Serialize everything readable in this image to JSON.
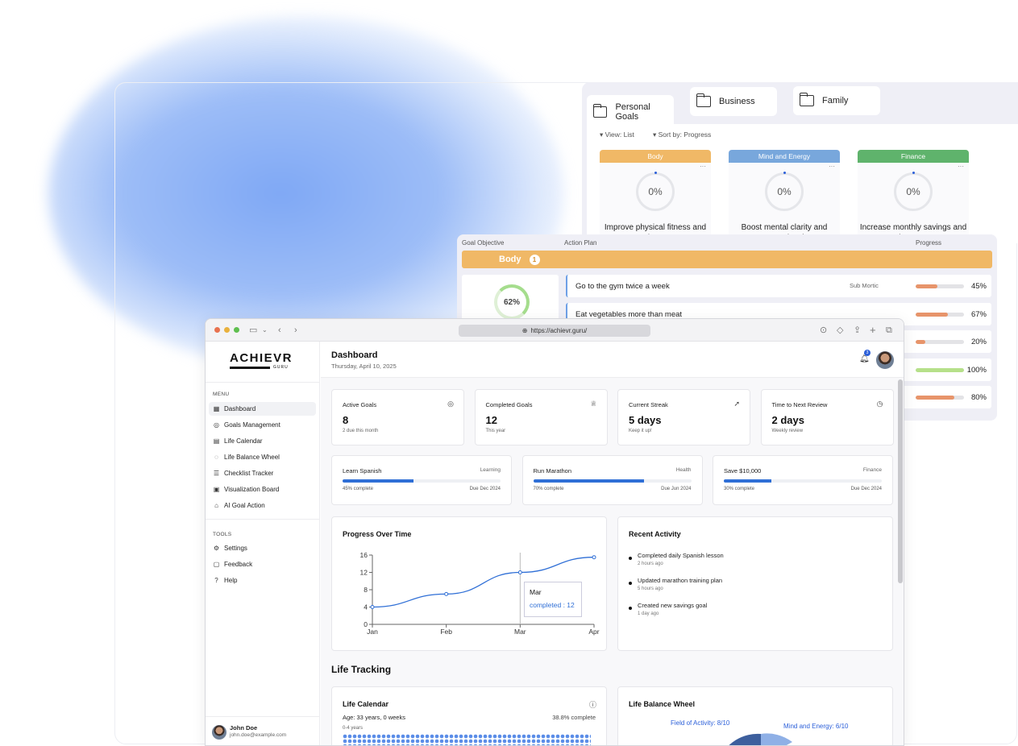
{
  "goals_board": {
    "tabs": [
      {
        "label": "Personal Goals"
      },
      {
        "label": "Business"
      },
      {
        "label": "Family"
      }
    ],
    "view_label": "View: List",
    "sort_label": "Sort by: Progress",
    "cards": [
      {
        "category": "Body",
        "color": "#f0b866",
        "progress": "0%",
        "title": "Improve physical fitness and endurance"
      },
      {
        "category": "Mind and Energy",
        "color": "#78a7dc",
        "progress": "0%",
        "title": "Boost mental clarity and energy levels"
      },
      {
        "category": "Finance",
        "color": "#5fb36c",
        "progress": "0%",
        "title": "Increase monthly savings and improve"
      }
    ]
  },
  "action_plan": {
    "col_objective": "Goal Objective",
    "col_plan": "Action Plan",
    "col_progress": "Progress",
    "group_label": "Body",
    "group_count": "1",
    "objective_progress": "62%",
    "rows": [
      {
        "text": "Go to the gym twice a week",
        "category": "Sub Mortic",
        "pct": "45%",
        "value": 0.45,
        "color": "#e7946a"
      },
      {
        "text": "Eat vegetables more than meat",
        "category": "",
        "pct": "67%",
        "value": 0.67,
        "color": "#e7946a"
      },
      {
        "text": "",
        "category": "",
        "pct": "20%",
        "value": 0.2,
        "color": "#e7946a"
      },
      {
        "text": "",
        "category": "",
        "pct": "100%",
        "value": 1.0,
        "color": "#b6e08a"
      },
      {
        "text": "",
        "category": "",
        "pct": "80%",
        "value": 0.8,
        "color": "#e7946a"
      }
    ]
  },
  "browser": {
    "url": "https://achievr.guru/"
  },
  "sidebar": {
    "logo": "ACHIEVR",
    "logo_sub": "GURU",
    "menu_heading": "MENU",
    "menu": [
      {
        "label": "Dashboard",
        "icon": "grid-icon"
      },
      {
        "label": "Goals Management",
        "icon": "target-icon"
      },
      {
        "label": "Life Calendar",
        "icon": "calendar-icon"
      },
      {
        "label": "Life Balance Wheel",
        "icon": "wheel-icon"
      },
      {
        "label": "Checklist Tracker",
        "icon": "checklist-icon"
      },
      {
        "label": "Visualization Board",
        "icon": "image-icon"
      },
      {
        "label": "AI Goal Action",
        "icon": "robot-icon"
      }
    ],
    "tools_heading": "TOOLS",
    "tools": [
      {
        "label": "Settings",
        "icon": "gear-icon"
      },
      {
        "label": "Feedback",
        "icon": "chat-icon"
      },
      {
        "label": "Help",
        "icon": "help-icon"
      }
    ],
    "user": {
      "name": "John Doe",
      "email": "john.doe@example.com"
    }
  },
  "header": {
    "title": "Dashboard",
    "date": "Thursday, April 10, 2025",
    "notifications": "3"
  },
  "stats": [
    {
      "label": "Active Goals",
      "value": "8",
      "sub": "2 due this month",
      "icon": "target-icon"
    },
    {
      "label": "Completed Goals",
      "value": "12",
      "sub": "This year",
      "icon": "trophy-icon"
    },
    {
      "label": "Current Streak",
      "value": "5 days",
      "sub": "Keep it up!",
      "icon": "rocket-icon"
    },
    {
      "label": "Time to Next Review",
      "value": "2 days",
      "sub": "Weekly review",
      "icon": "clock-icon"
    }
  ],
  "goal_progress": [
    {
      "name": "Learn Spanish",
      "category": "Learning",
      "progress": 0.45,
      "status": "45% complete",
      "due": "Due Dec 2024"
    },
    {
      "name": "Run Marathon",
      "category": "Health",
      "progress": 0.7,
      "status": "70% complete",
      "due": "Due Jun 2024"
    },
    {
      "name": "Save $10,000",
      "category": "Finance",
      "progress": 0.3,
      "status": "30% complete",
      "due": "Due Dec 2024"
    }
  ],
  "progress_chart": {
    "title": "Progress Over Time",
    "tooltip_label": "Mar",
    "tooltip_value": "completed : 12"
  },
  "chart_data": {
    "type": "line",
    "categories": [
      "Jan",
      "Feb",
      "Mar",
      "Apr"
    ],
    "series": [
      {
        "name": "completed",
        "values": [
          4,
          7,
          12,
          15.5
        ]
      }
    ],
    "yticks": [
      0,
      4,
      8,
      12,
      16
    ],
    "ylim": [
      0,
      16
    ],
    "color": "#2f6fd6"
  },
  "recent_activity": {
    "title": "Recent Activity",
    "items": [
      {
        "text": "Completed daily Spanish lesson",
        "time": "2 hours ago"
      },
      {
        "text": "Updated marathon training plan",
        "time": "5 hours ago"
      },
      {
        "text": "Created new savings goal",
        "time": "1 day ago"
      }
    ]
  },
  "life_tracking": {
    "heading": "Life Tracking",
    "calendar": {
      "title": "Life Calendar",
      "age": "Age: 33 years, 0 weeks",
      "complete": "38.8% complete",
      "range": "0-4 years"
    },
    "wheel": {
      "title": "Life Balance Wheel",
      "label_1": "Field of Activity: 8/10",
      "label_2": "Mind and Energy: 6/10"
    }
  }
}
